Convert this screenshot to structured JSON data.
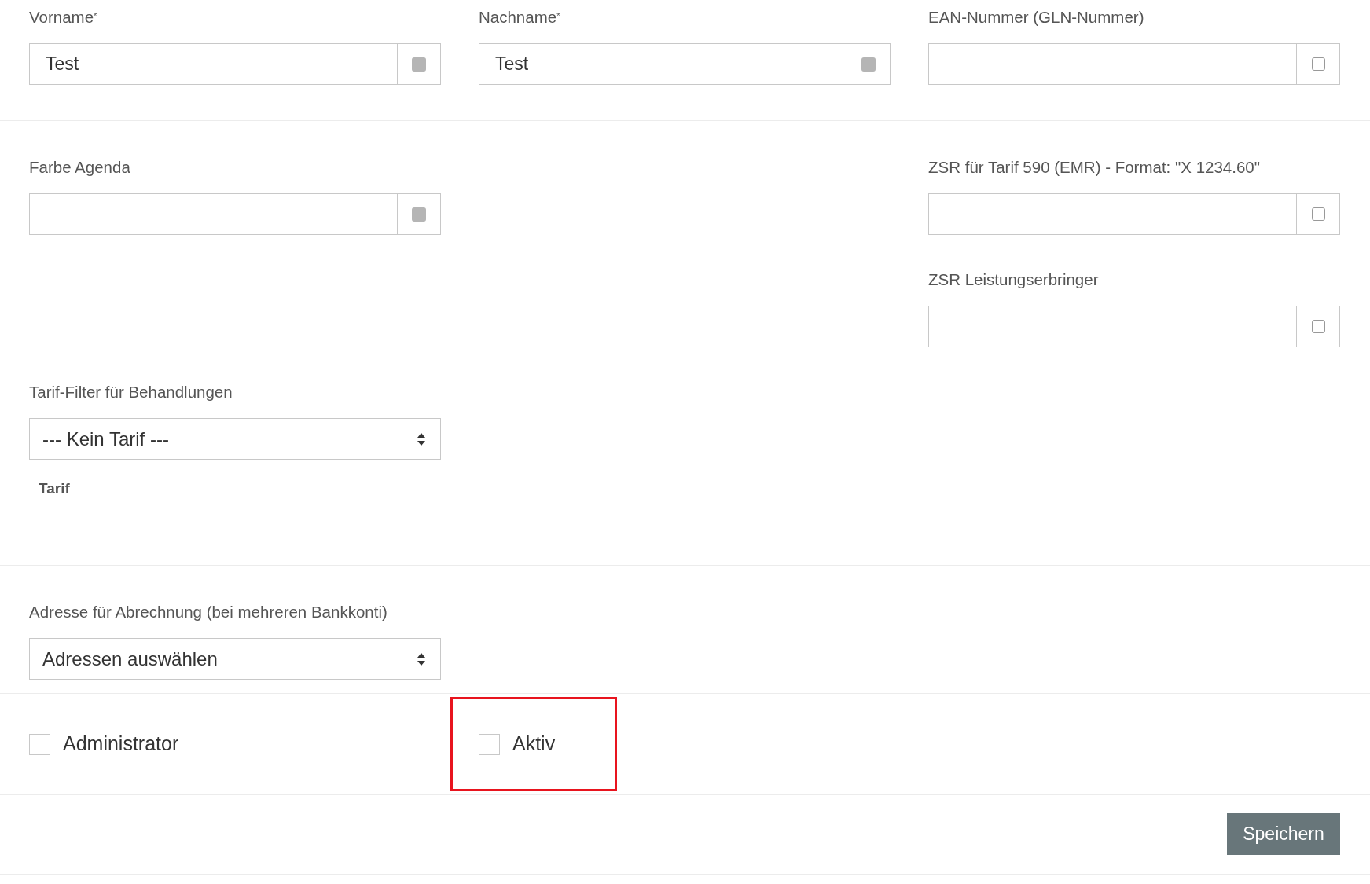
{
  "sections": [
    {
      "rows": [
        [
          {
            "kind": "input",
            "label": "Vorname$^{*}$",
            "value": "Test",
            "addon_disabled": true
          },
          {
            "kind": "input",
            "label": "Nachname$^{*}$",
            "value": "Test",
            "addon_disabled": true
          },
          {
            "kind": "input",
            "label": "EAN-Nummer (GLN-Nummer)",
            "addon_disabled": false
          }
        ]
      ]
    },
    {
      "rows": [
        [
          {
            "kind": "input",
            "label": "Farbe Agenda",
            "addon_disabled": true
          },
          null,
          {
            "kind": "input",
            "label": "ZSR für Tarif 590 (EMR) - Format: \"X 1234.60\"",
            "addon_disabled": false
          }
        ],
        [
          null,
          null,
          {
            "kind": "input",
            "label": "ZSR Leistungserbringer",
            "addon_disabled": false
          }
        ],
        [
          {
            "kind": "select",
            "label": "Tarif-Filter für Behandlungen",
            "value": "--- Kein Tarif ---",
            "note": "Tarif"
          },
          null,
          null
        ]
      ]
    },
    {
      "rows": [
        [
          {
            "kind": "select",
            "label": "Adresse für Abrechnung (bei mehreren Bankkonti)",
            "value": "Adressen auswählen"
          },
          null,
          null
        ]
      ]
    }
  ],
  "checkboxes": [
    {
      "label": "Administrator",
      "checked": false,
      "highlighted": false
    },
    {
      "label": "Aktiv",
      "checked": false,
      "highlighted": true
    }
  ],
  "save_button": "Speichern"
}
